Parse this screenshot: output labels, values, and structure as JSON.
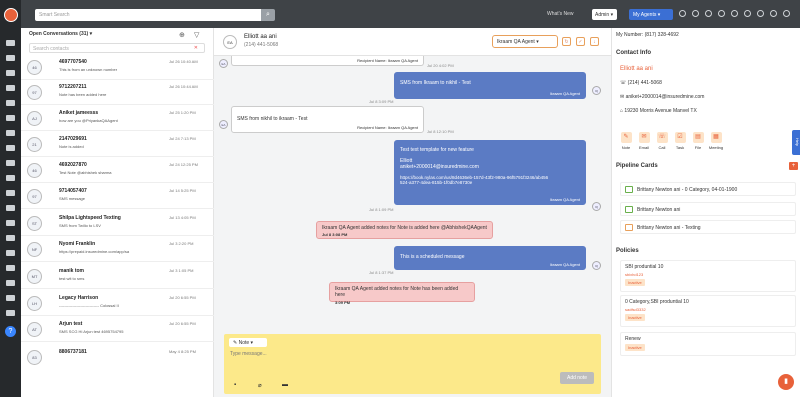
{
  "topbar": {
    "search_placeholder": "Smart Search",
    "whats_new": "What's New",
    "role": "Admin",
    "my_agents": "My Agents"
  },
  "conversations": {
    "header": "Open Conversations (31)",
    "search_placeholder": "Search contacts",
    "items": [
      {
        "initials": "46",
        "name": "4697707540",
        "preview": "This is from an unknown number",
        "date": "Jul 26 10:40 AM"
      },
      {
        "initials": "97",
        "name": "9712207211",
        "preview": "Note has been added here",
        "date": "Jul 26 10:44 AM"
      },
      {
        "initials": "AJ",
        "name": "Aniket jameesss",
        "preview": "how are you @PriyankaQAAgent",
        "date": "Jul 25 1:20 PM"
      },
      {
        "initials": "21",
        "name": "2147029691",
        "preview": "Note is added",
        "date": "Jul 24 7:13 PM"
      },
      {
        "initials": "46",
        "name": "4692027870",
        "preview": "Test Note @abhishek sharma",
        "date": "Jul 24 12:25 PM"
      },
      {
        "initials": "97",
        "name": "9714057407",
        "preview": "SMS message",
        "date": "Jul 14 5:25 PM"
      },
      {
        "initials": "ST",
        "name": "Shilpa Lightspeed Texting",
        "preview": "SMS from Twilio to LSV",
        "date": "Jul 13 4:05 PM"
      },
      {
        "initials": "NF",
        "name": "Nyomi Franklin",
        "preview": "https://prepaid.insuredmine.com/app/sa",
        "date": "Jul 3 2:20 PM"
      },
      {
        "initials": "MT",
        "name": "manik tom",
        "preview": "test wit to sms",
        "date": "Jul 3 1:05 PM"
      },
      {
        "initials": "LH",
        "name": "Legacy Harrison",
        "preview": "------------------------------ Colossal II",
        "date": "Jul 20 6:55 PM"
      },
      {
        "initials": "AT",
        "name": "Arjun test",
        "preview": "SMS SCG Hi Arjun test 4695754795",
        "date": "Jul 20 6:55 PM"
      },
      {
        "initials": "83",
        "name": "8806737181",
        "preview": "",
        "date": "May 4 8:25 PM"
      }
    ]
  },
  "chat": {
    "contact_initials": "EA",
    "contact_name": "Elliott aa ani",
    "contact_phone": "(214) 441-5068",
    "agent": "Ikraam QA Agent",
    "messages": {
      "m1_recipient": "Recipient Name: Ikraam QA Agent",
      "m1_time": "Jul 20 4:02 PM",
      "m2_text": "SMS from Ikraam to nikhil - Test",
      "m2_agent": "Ikraam QA Agent",
      "m2_time": "Jul 8 3:09 PM",
      "m3_text": "SMS from nikhil to ikraam - Test",
      "m3_recipient": "Recipient Name: Ikraam QA Agent",
      "m3_time": "Jul 8 12:10 PM",
      "m4_line1": "Test text template for new feature",
      "m4_line2": "Elliott",
      "m4_line3": "aniket+2000014@insuredmine.com",
      "m4_line4": "https://book.nylas.com/us/8d4636eb-157d-43f2-980a-96f5791f3246/ab456524-a377-4dea-815b-1f0db7e8730e",
      "m4_agent": "Ikraam QA Agent",
      "m4_time": "Jul 8 1:09 PM",
      "n1_text": "Ikraam QA Agent added notes for Note is added here @AbhishekQAAgent",
      "n1_time": "Jul 8 3:08 PM",
      "m5_text": "This is a scheduled message",
      "m5_agent": "Ikraam QA Agent",
      "m5_time": "Jul 8 1:37 PM",
      "n2_text": "Ikraam QA Agent added notes for Note has been added here",
      "n2_time": "3:09 PM"
    },
    "compose": {
      "type": "Note",
      "placeholder": "Type message...",
      "add_note": "Add note"
    }
  },
  "contact": {
    "my_number": "My Number: (817) 328-4692",
    "section_info": "Contact Info",
    "name": "Elliott aa ani",
    "phone": "(214) 441-5068",
    "email": "aniket+2000014@insuredmine.com",
    "address": "19230 Morris Avenue Manvel TX",
    "actions": [
      "Note",
      "Email",
      "Call",
      "Task",
      "File",
      "Meeting"
    ],
    "section_pipeline": "Pipeline Cards",
    "pipelines": [
      "Brittany Newton ani - 0 Category, 04-01-1900",
      "Brittany Newton ani",
      "Brittany Newton ani - Texting"
    ],
    "section_policies": "Policies",
    "policies": [
      {
        "name": "SBI produntial 10",
        "link": "sbixhd123",
        "status": "Inactive"
      },
      {
        "name": "0 Category,SBI produntial 10",
        "link": "sadfsd3332",
        "status": "Inactive"
      },
      {
        "name": "Renew",
        "link": "",
        "status": "Inactive"
      }
    ]
  },
  "help_tab": "Help"
}
